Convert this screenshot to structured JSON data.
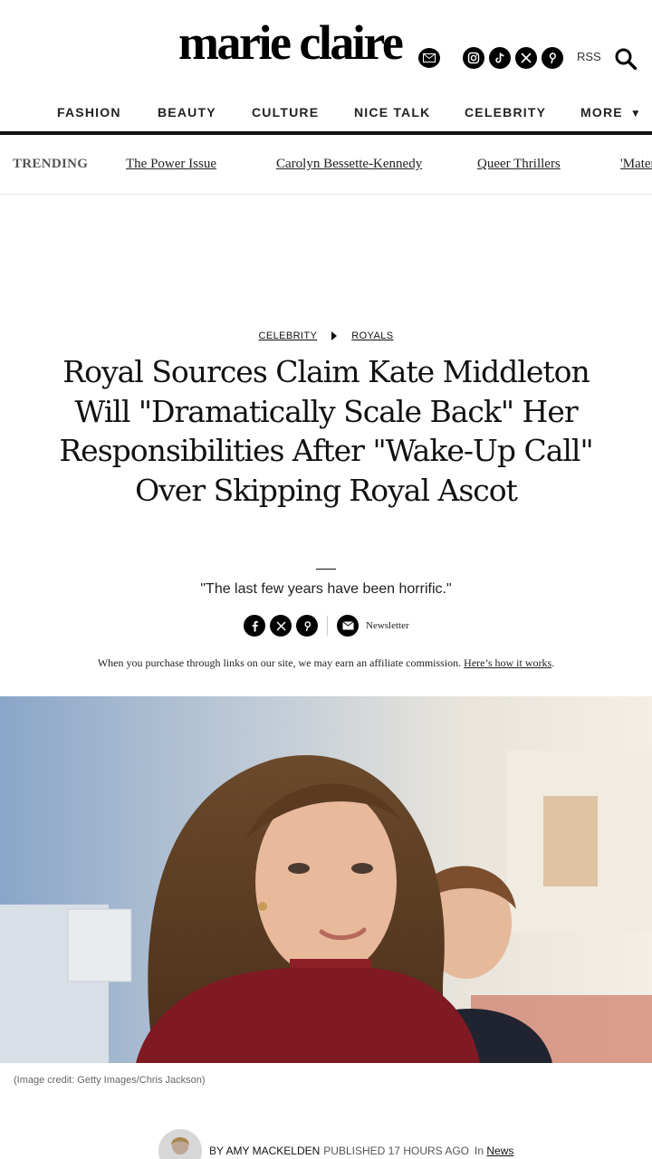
{
  "brand": {
    "logo_text": "marie claire"
  },
  "header": {
    "social_icons": [
      "instagram-icon",
      "tiktok-icon",
      "x-icon",
      "pinterest-icon"
    ],
    "rss_label": "RSS"
  },
  "nav": {
    "items": [
      "FASHION",
      "BEAUTY",
      "CULTURE",
      "NICE TALK",
      "CELEBRITY",
      "MORE"
    ]
  },
  "trending": {
    "label": "TRENDING",
    "links": [
      "The Power Issue",
      "Carolyn Bessette-Kennedy",
      "Queer Thrillers",
      "'Materialists'"
    ]
  },
  "article": {
    "breadcrumb": [
      "CELEBRITY",
      "ROYALS"
    ],
    "headline": "Royal Sources Claim Kate Middleton Will \"Dramatically Scale Back\" Her Responsibilities After \"Wake-Up Call\" Over Skipping Royal Ascot",
    "strapline": "\"The last few years have been horrific.\"",
    "share_icons": [
      "facebook-icon",
      "x-icon",
      "pinterest-icon"
    ],
    "newsletter_label": "Newsletter",
    "affiliate_text": "When you purchase through links on our site, we may earn an affiliate commission.",
    "affiliate_link": "Here’s how it works",
    "affiliate_end": ".",
    "image_caption": "(Image credit: Getty Images/Chris Jackson)",
    "byline": {
      "by": "BY",
      "author": "AMY MACKELDEN",
      "published": "PUBLISHED 17 HOURS AGO",
      "in": "In",
      "category": "News"
    }
  },
  "colors": {
    "text": "#111111",
    "rule": "#111111",
    "muted": "#666666"
  }
}
